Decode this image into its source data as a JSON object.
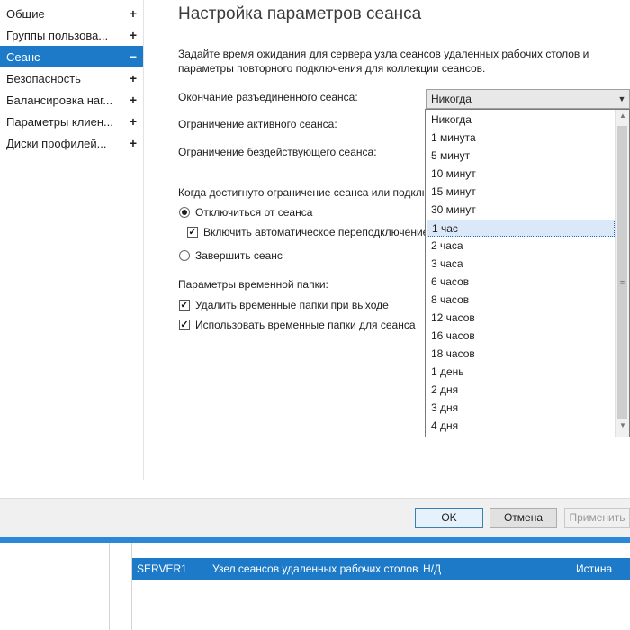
{
  "sidebar": {
    "items": [
      {
        "label": "Общие",
        "toggle": "+"
      },
      {
        "label": "Группы пользова...",
        "toggle": "+"
      },
      {
        "label": "Сеанс",
        "toggle": "−"
      },
      {
        "label": "Безопасность",
        "toggle": "+"
      },
      {
        "label": "Балансировка наг...",
        "toggle": "+"
      },
      {
        "label": "Параметры клиен...",
        "toggle": "+"
      },
      {
        "label": "Диски профилей...",
        "toggle": "+"
      }
    ]
  },
  "main": {
    "title": "Настройка параметров сеанса",
    "description_line1": "Задайте время ожидания для сервера узла сеансов удаленных рабочих столов и",
    "description_line2": "параметры повторного подключения для коллекции сеансов.",
    "fields": {
      "disconnected_label": "Окончание разъединенного сеанса:",
      "active_label": "Ограничение активного сеанса:",
      "idle_label": "Ограничение бездействующего сеанса:"
    },
    "limit_heading": "Когда достигнуто ограничение сеанса или подключение прервано:",
    "radio_disconnect": "Отключиться от сеанса",
    "check_reconnect": "Включить автоматическое переподключение",
    "radio_end": "Завершить сеанс",
    "temp_heading": "Параметры временной папки:",
    "check_delete_temp": "Удалить временные папки при выходе",
    "check_use_temp": "Использовать временные папки для сеанса"
  },
  "combo": {
    "value": "Никогда",
    "arrow_icon": "▼"
  },
  "dropdown": {
    "options": [
      "Никогда",
      "1 минута",
      "5 минут",
      "10 минут",
      "15 минут",
      "30 минут",
      "1 час",
      "2 часа",
      "3 часа",
      "6 часов",
      "8 часов",
      "12 часов",
      "16 часов",
      "18 часов",
      "1 день",
      "2 дня",
      "3 дня",
      "4 дня"
    ],
    "highlighted": "1 час"
  },
  "buttons": {
    "ok": "OK",
    "cancel": "Отмена",
    "apply": "Применить"
  },
  "table": {
    "row": {
      "server": "SERVER1",
      "role": "Узел сеансов удаленных рабочих столов",
      "status": "Н/Д",
      "value": "Истина"
    }
  },
  "colors": {
    "accent": "#1c7ac9",
    "band": "#2b88d8"
  }
}
